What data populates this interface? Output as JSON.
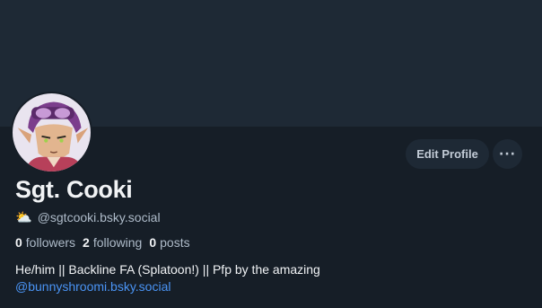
{
  "profile": {
    "display_name": "Sgt. Cooki",
    "handle_emoji": "⛅",
    "handle": "@sgtcooki.bsky.social",
    "stats": {
      "followers_count": "0",
      "followers_label": "followers",
      "following_count": "2",
      "following_label": "following",
      "posts_count": "0",
      "posts_label": "posts"
    },
    "bio_text": "He/him || Backline FA (Splatoon!) || Pfp by the amazing",
    "bio_link": "@bunnyshroomi.bsky.social"
  },
  "actions": {
    "edit_label": "Edit Profile",
    "more_label": "···"
  },
  "colors": {
    "background": "#161e27",
    "banner": "#1e2935",
    "link": "#4a94f5",
    "muted_text": "#aebbc9"
  }
}
